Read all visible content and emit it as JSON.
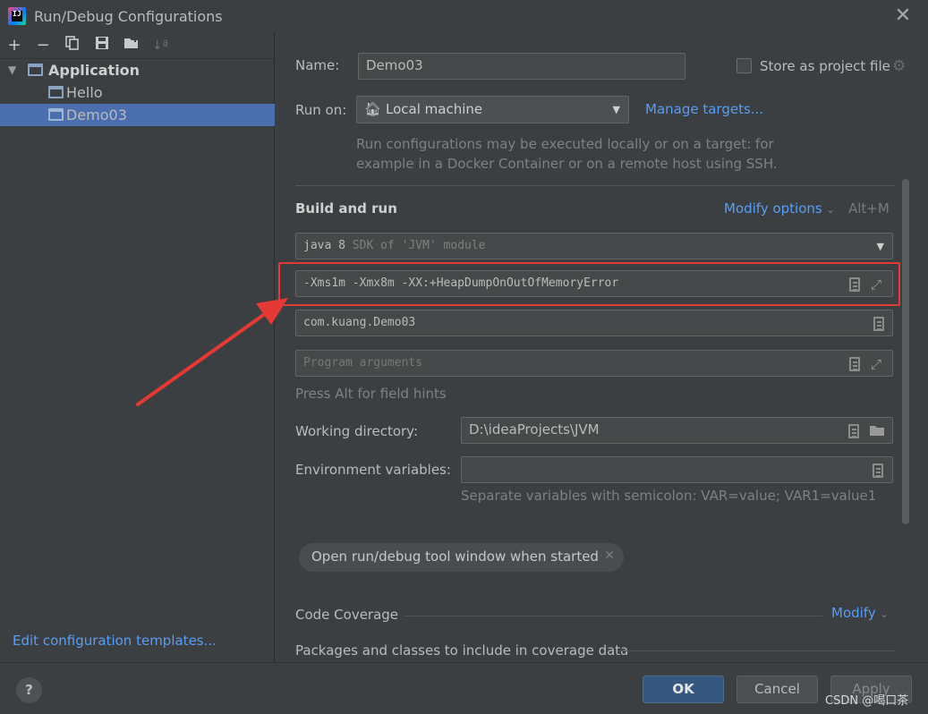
{
  "window": {
    "title": "Run/Debug Configurations"
  },
  "toolbar": {
    "add": "+",
    "remove": "−",
    "sort": "↓ª"
  },
  "tree": {
    "group": "Application",
    "items": [
      {
        "label": "Hello"
      },
      {
        "label": "Demo03"
      }
    ]
  },
  "left_footer": {
    "edit_templates": "Edit configuration templates..."
  },
  "form": {
    "name_label": "Name:",
    "name_value": "Demo03",
    "store_label": "Store as project file",
    "run_on_label": "Run on:",
    "run_on_value": "Local machine",
    "manage_targets": "Manage targets...",
    "run_on_hint_1": "Run configurations may be executed locally or on a target: for",
    "run_on_hint_2": "example in a Docker Container or on a remote host using SSH.",
    "build_run_title": "Build and run",
    "modify_options": "Modify options",
    "modify_shortcut": "Alt+M",
    "sdk_value": "java 8",
    "sdk_hint": "SDK of 'JVM' module",
    "vm_options": "-Xms1m -Xmx8m -XX:+HeapDumpOnOutOfMemoryError",
    "main_class": "com.kuang.Demo03",
    "program_args_placeholder": "Program arguments",
    "field_hints": "Press Alt for field hints",
    "working_dir_label": "Working directory:",
    "working_dir_value": "D:\\ideaProjects\\JVM",
    "env_vars_label": "Environment variables:",
    "env_vars_value": "",
    "env_vars_hint": "Separate variables with semicolon: VAR=value; VAR1=value1",
    "chip_label": "Open run/debug tool window when started",
    "code_coverage": "Code Coverage",
    "coverage_modify": "Modify",
    "packages_label": "Packages and classes to include in coverage data"
  },
  "buttons": {
    "ok": "OK",
    "cancel": "Cancel",
    "apply": "Apply",
    "help": "?"
  },
  "watermark": "CSDN @喝口茶",
  "colors": {
    "accent": "#589df6",
    "selection": "#4b6eaf",
    "annotation": "#e53935"
  }
}
